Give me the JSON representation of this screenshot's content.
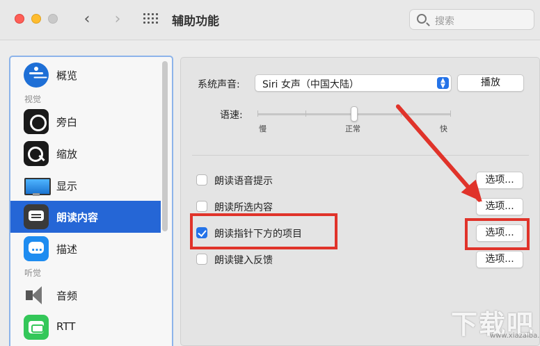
{
  "window": {
    "title": "辅助功能",
    "search_placeholder": "搜索"
  },
  "sidebar": {
    "items": [
      {
        "label": "概览",
        "icon": "accessibility-icon"
      },
      {
        "label": "旁白",
        "icon": "voiceover-icon"
      },
      {
        "label": "缩放",
        "icon": "zoom-icon"
      },
      {
        "label": "显示",
        "icon": "display-icon"
      },
      {
        "label": "朗读内容",
        "icon": "spoken-content-icon",
        "selected": true
      },
      {
        "label": "描述",
        "icon": "descriptions-icon"
      },
      {
        "label": "音频",
        "icon": "audio-icon"
      },
      {
        "label": "RTT",
        "icon": "rtt-icon"
      }
    ],
    "sections": {
      "vision": "视觉",
      "hearing": "听觉"
    }
  },
  "main": {
    "voice_label": "系统声音:",
    "voice_value": "Siri 女声（中国大陆）",
    "play_button": "播放",
    "rate_label": "语速:",
    "rate_slow": "慢",
    "rate_normal": "正常",
    "rate_fast": "快",
    "rate_value_fraction": 0.5,
    "options": [
      {
        "label": "朗读语音提示",
        "checked": false,
        "button": "选项..."
      },
      {
        "label": "朗读所选内容",
        "checked": false,
        "button": "选项..."
      },
      {
        "label": "朗读指针下方的项目",
        "checked": true,
        "button": "选项..."
      },
      {
        "label": "朗读键入反馈",
        "checked": false,
        "button": "选项..."
      }
    ]
  },
  "colors": {
    "accent": "#2573e8",
    "selection": "#2566d6",
    "annotation": "#e0332a"
  },
  "watermark": {
    "text": "下载吧",
    "url": "www.xiazaiba.com"
  }
}
